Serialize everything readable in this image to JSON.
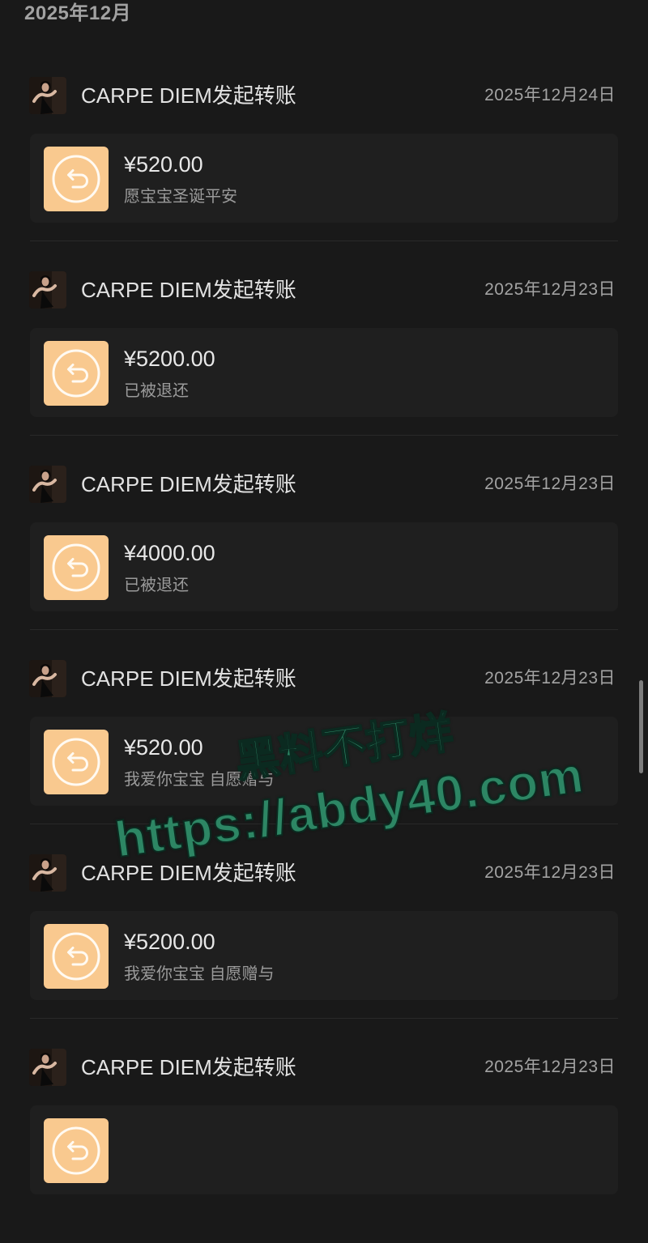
{
  "header": {
    "month": "2025年12月"
  },
  "entries": [
    {
      "title": "CARPE DIEM发起转账",
      "date": "2025年12月24日",
      "amount": "¥520.00",
      "note": "愿宝宝圣诞平安"
    },
    {
      "title": "CARPE DIEM发起转账",
      "date": "2025年12月23日",
      "amount": "¥5200.00",
      "note": "已被退还"
    },
    {
      "title": "CARPE DIEM发起转账",
      "date": "2025年12月23日",
      "amount": "¥4000.00",
      "note": "已被退还"
    },
    {
      "title": "CARPE DIEM发起转账",
      "date": "2025年12月23日",
      "amount": "¥520.00",
      "note": "我爱你宝宝 自愿赠与"
    },
    {
      "title": "CARPE DIEM发起转账",
      "date": "2025年12月23日",
      "amount": "¥5200.00",
      "note": "我爱你宝宝 自愿赠与"
    },
    {
      "title": "CARPE DIEM发起转账",
      "date": "2025年12月23日"
    }
  ],
  "icons": {
    "avatar": "avatar-photo",
    "transfer": "transfer-return-icon"
  },
  "watermark": {
    "line1": "黑料不打烊",
    "line2": "https://abdy40.com"
  },
  "colors": {
    "background": "#191919",
    "card": "#1f1f1f",
    "transfer_icon_bg": "#f9c98f",
    "watermark": "#2d8664"
  }
}
